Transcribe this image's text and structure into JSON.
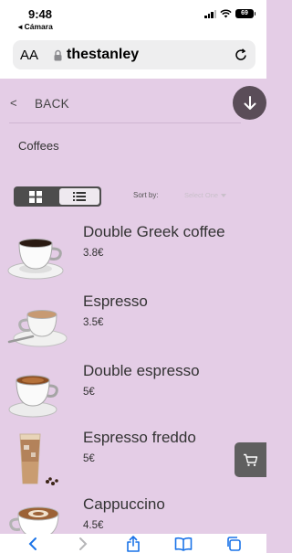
{
  "status_bar": {
    "time": "9:48",
    "back_app": "◂ Cámara",
    "battery": "69"
  },
  "address_bar": {
    "text_size": "AA",
    "domain": "thestanley"
  },
  "page": {
    "back_label": "BACK",
    "category": "Coffees",
    "sort_label": "Sort by:",
    "sort_value": "Select One",
    "products": [
      {
        "name": "Double Greek coffee",
        "price": "3.8€",
        "icon": "double-greek-coffee-image"
      },
      {
        "name": "Espresso",
        "price": "3.5€",
        "icon": "espresso-image"
      },
      {
        "name": "Double espresso",
        "price": "5€",
        "icon": "double-espresso-image"
      },
      {
        "name": "Espresso freddo",
        "price": "5€",
        "icon": "espresso-freddo-image"
      },
      {
        "name": "Cappuccino",
        "price": "4.5€",
        "icon": "cappuccino-image"
      }
    ]
  },
  "colors": {
    "page_background": "#e4cde6",
    "dark_button": "#5a4d58",
    "safari_blue": "#1a73e8"
  }
}
